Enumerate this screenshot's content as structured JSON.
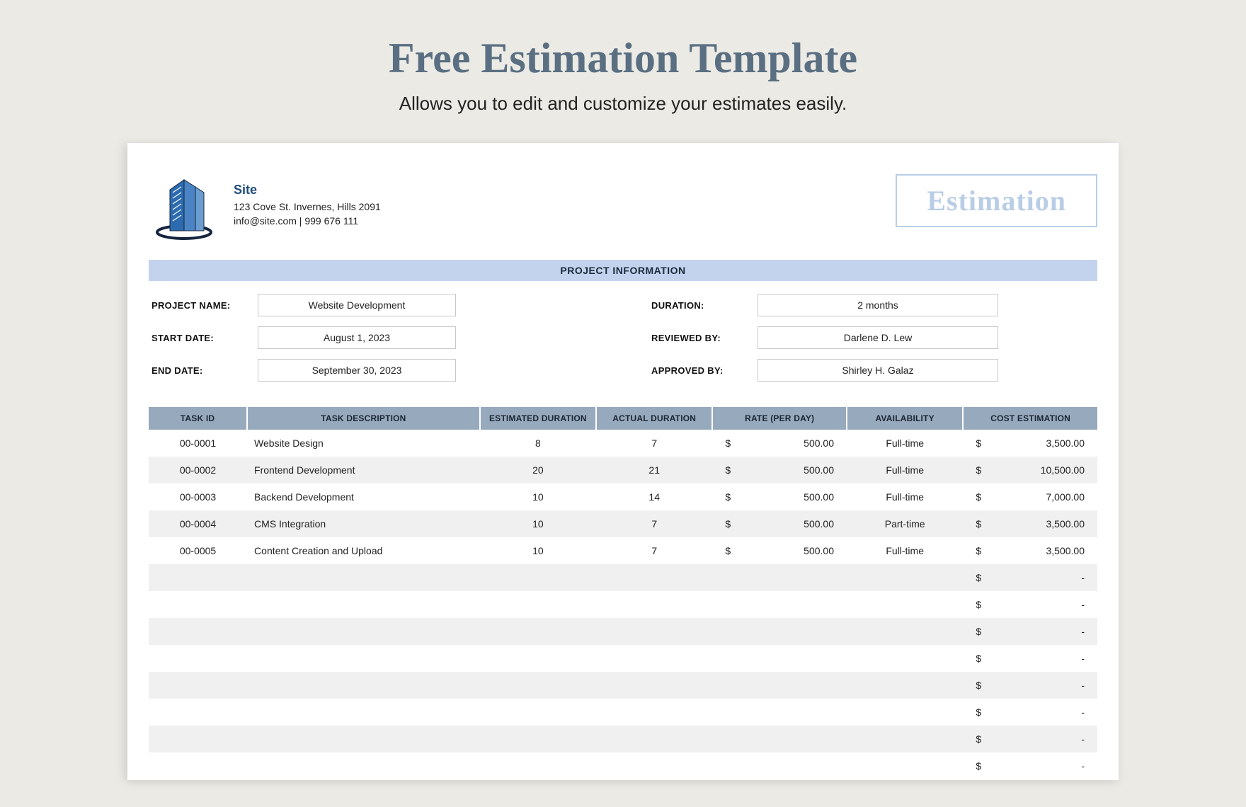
{
  "page": {
    "title": "Free Estimation Template",
    "subtitle": "Allows you to edit and customize your estimates easily."
  },
  "company": {
    "name": "Site",
    "address": "123 Cove St. Invernes, Hills 2091",
    "contact": "info@site.com | 999 676 111"
  },
  "badge": "Estimation",
  "section_header": "PROJECT INFORMATION",
  "info": {
    "labels": {
      "project_name": "PROJECT NAME:",
      "start_date": "START DATE:",
      "end_date": "END DATE:",
      "duration": "DURATION:",
      "reviewed_by": "REVIEWED BY:",
      "approved_by": "APPROVED BY:"
    },
    "values": {
      "project_name": "Website Development",
      "start_date": "August 1, 2023",
      "end_date": "September 30, 2023",
      "duration": "2 months",
      "reviewed_by": "Darlene D. Lew",
      "approved_by": "Shirley H. Galaz"
    }
  },
  "columns": {
    "task_id": "TASK ID",
    "task_desc": "TASK DESCRIPTION",
    "est_dur": "ESTIMATED DURATION",
    "act_dur": "ACTUAL DURATION",
    "rate": "RATE (PER DAY)",
    "avail": "AVAILABILITY",
    "cost": "COST ESTIMATION"
  },
  "rows": [
    {
      "id": "00-0001",
      "desc": "Website Design",
      "est": "8",
      "act": "7",
      "rate": "500.00",
      "avail": "Full-time",
      "cost": "3,500.00"
    },
    {
      "id": "00-0002",
      "desc": "Frontend Development",
      "est": "20",
      "act": "21",
      "rate": "500.00",
      "avail": "Full-time",
      "cost": "10,500.00"
    },
    {
      "id": "00-0003",
      "desc": "Backend Development",
      "est": "10",
      "act": "14",
      "rate": "500.00",
      "avail": "Full-time",
      "cost": "7,000.00"
    },
    {
      "id": "00-0004",
      "desc": "CMS Integration",
      "est": "10",
      "act": "7",
      "rate": "500.00",
      "avail": "Part-time",
      "cost": "3,500.00"
    },
    {
      "id": "00-0005",
      "desc": "Content Creation and Upload",
      "est": "10",
      "act": "7",
      "rate": "500.00",
      "avail": "Full-time",
      "cost": "3,500.00"
    }
  ],
  "empty_rows": 8,
  "currency": "$",
  "dash": "-"
}
